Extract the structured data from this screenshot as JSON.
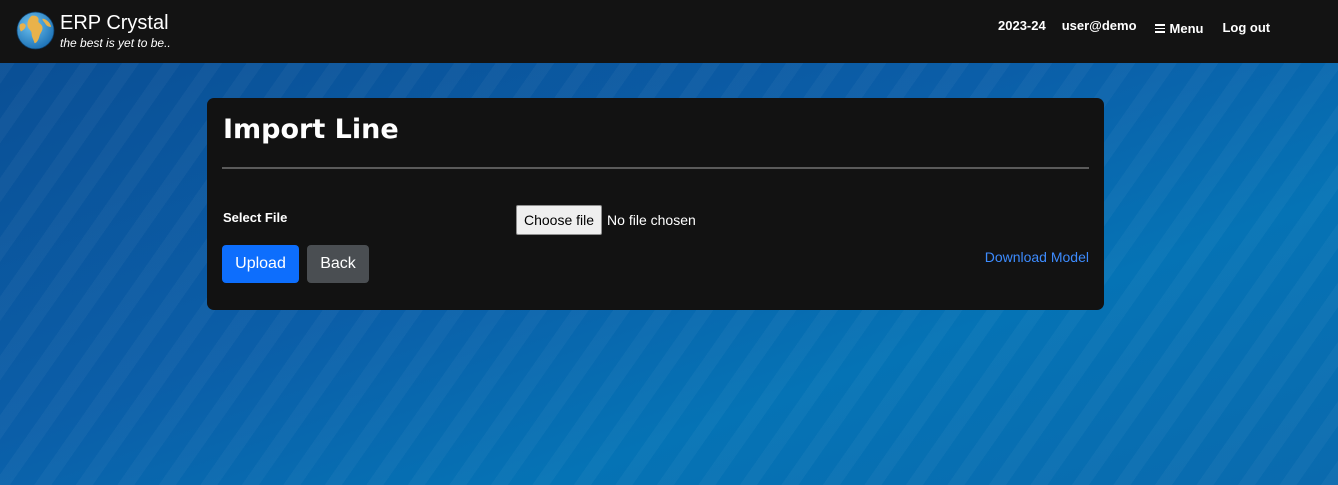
{
  "header": {
    "brand_title": "ERP Crystal",
    "brand_tagline": "the best is yet to be..",
    "logo_icon": "globe-icon",
    "fiscal_year": "2023-24",
    "user": "user@demo",
    "menu_label": "Menu",
    "menu_icon": "hamburger-icon",
    "logout_label": "Log out"
  },
  "card": {
    "title": "Import Line",
    "file_field": {
      "label": "Select File",
      "button_label": "Choose file",
      "status": "No file chosen"
    },
    "upload_label": "Upload",
    "back_label": "Back",
    "download_label": "Download Model"
  },
  "colors": {
    "navbar_bg": "#131313",
    "card_bg": "#121212",
    "primary": "#0d6efd",
    "secondary": "#4a4e52",
    "link": "#3d8bfd"
  }
}
